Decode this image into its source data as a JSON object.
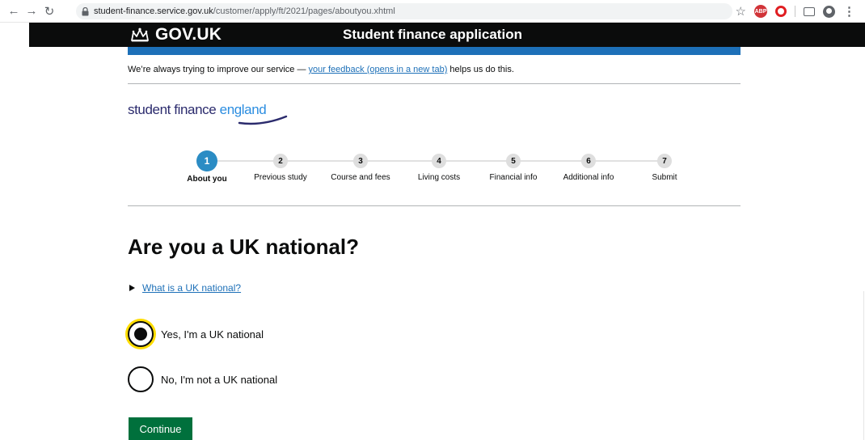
{
  "browser": {
    "url_host": "student-finance.service.gov.uk",
    "url_path": "/customer/apply/ft/2021/pages/aboutyou.xhtml",
    "abp_label": "ABP"
  },
  "header": {
    "logo_text": "GOV.UK",
    "service_name": "Student finance application",
    "bar_color": "#1d70b8"
  },
  "feedback": {
    "prefix": "We’re always trying to improve our service — ",
    "link_text": "your feedback (opens in a new tab)",
    "suffix": " helps us do this."
  },
  "brand": {
    "sf": "student finance ",
    "eng": "england"
  },
  "steps": [
    {
      "number": "1",
      "label": "About you",
      "active": true
    },
    {
      "number": "2",
      "label": "Previous study"
    },
    {
      "number": "3",
      "label": "Course and fees"
    },
    {
      "number": "4",
      "label": "Living costs"
    },
    {
      "number": "5",
      "label": "Financial info"
    },
    {
      "number": "6",
      "label": "Additional info"
    },
    {
      "number": "7",
      "label": "Submit"
    }
  ],
  "question": {
    "title": "Are you a UK national?",
    "details_link": "What is a UK national?",
    "options": [
      {
        "label": "Yes, I'm a UK national",
        "checked": true
      },
      {
        "label": "No, I'm not a UK national",
        "checked": false
      }
    ]
  },
  "actions": {
    "continue_label": "Continue",
    "button_color": "#00703c"
  }
}
